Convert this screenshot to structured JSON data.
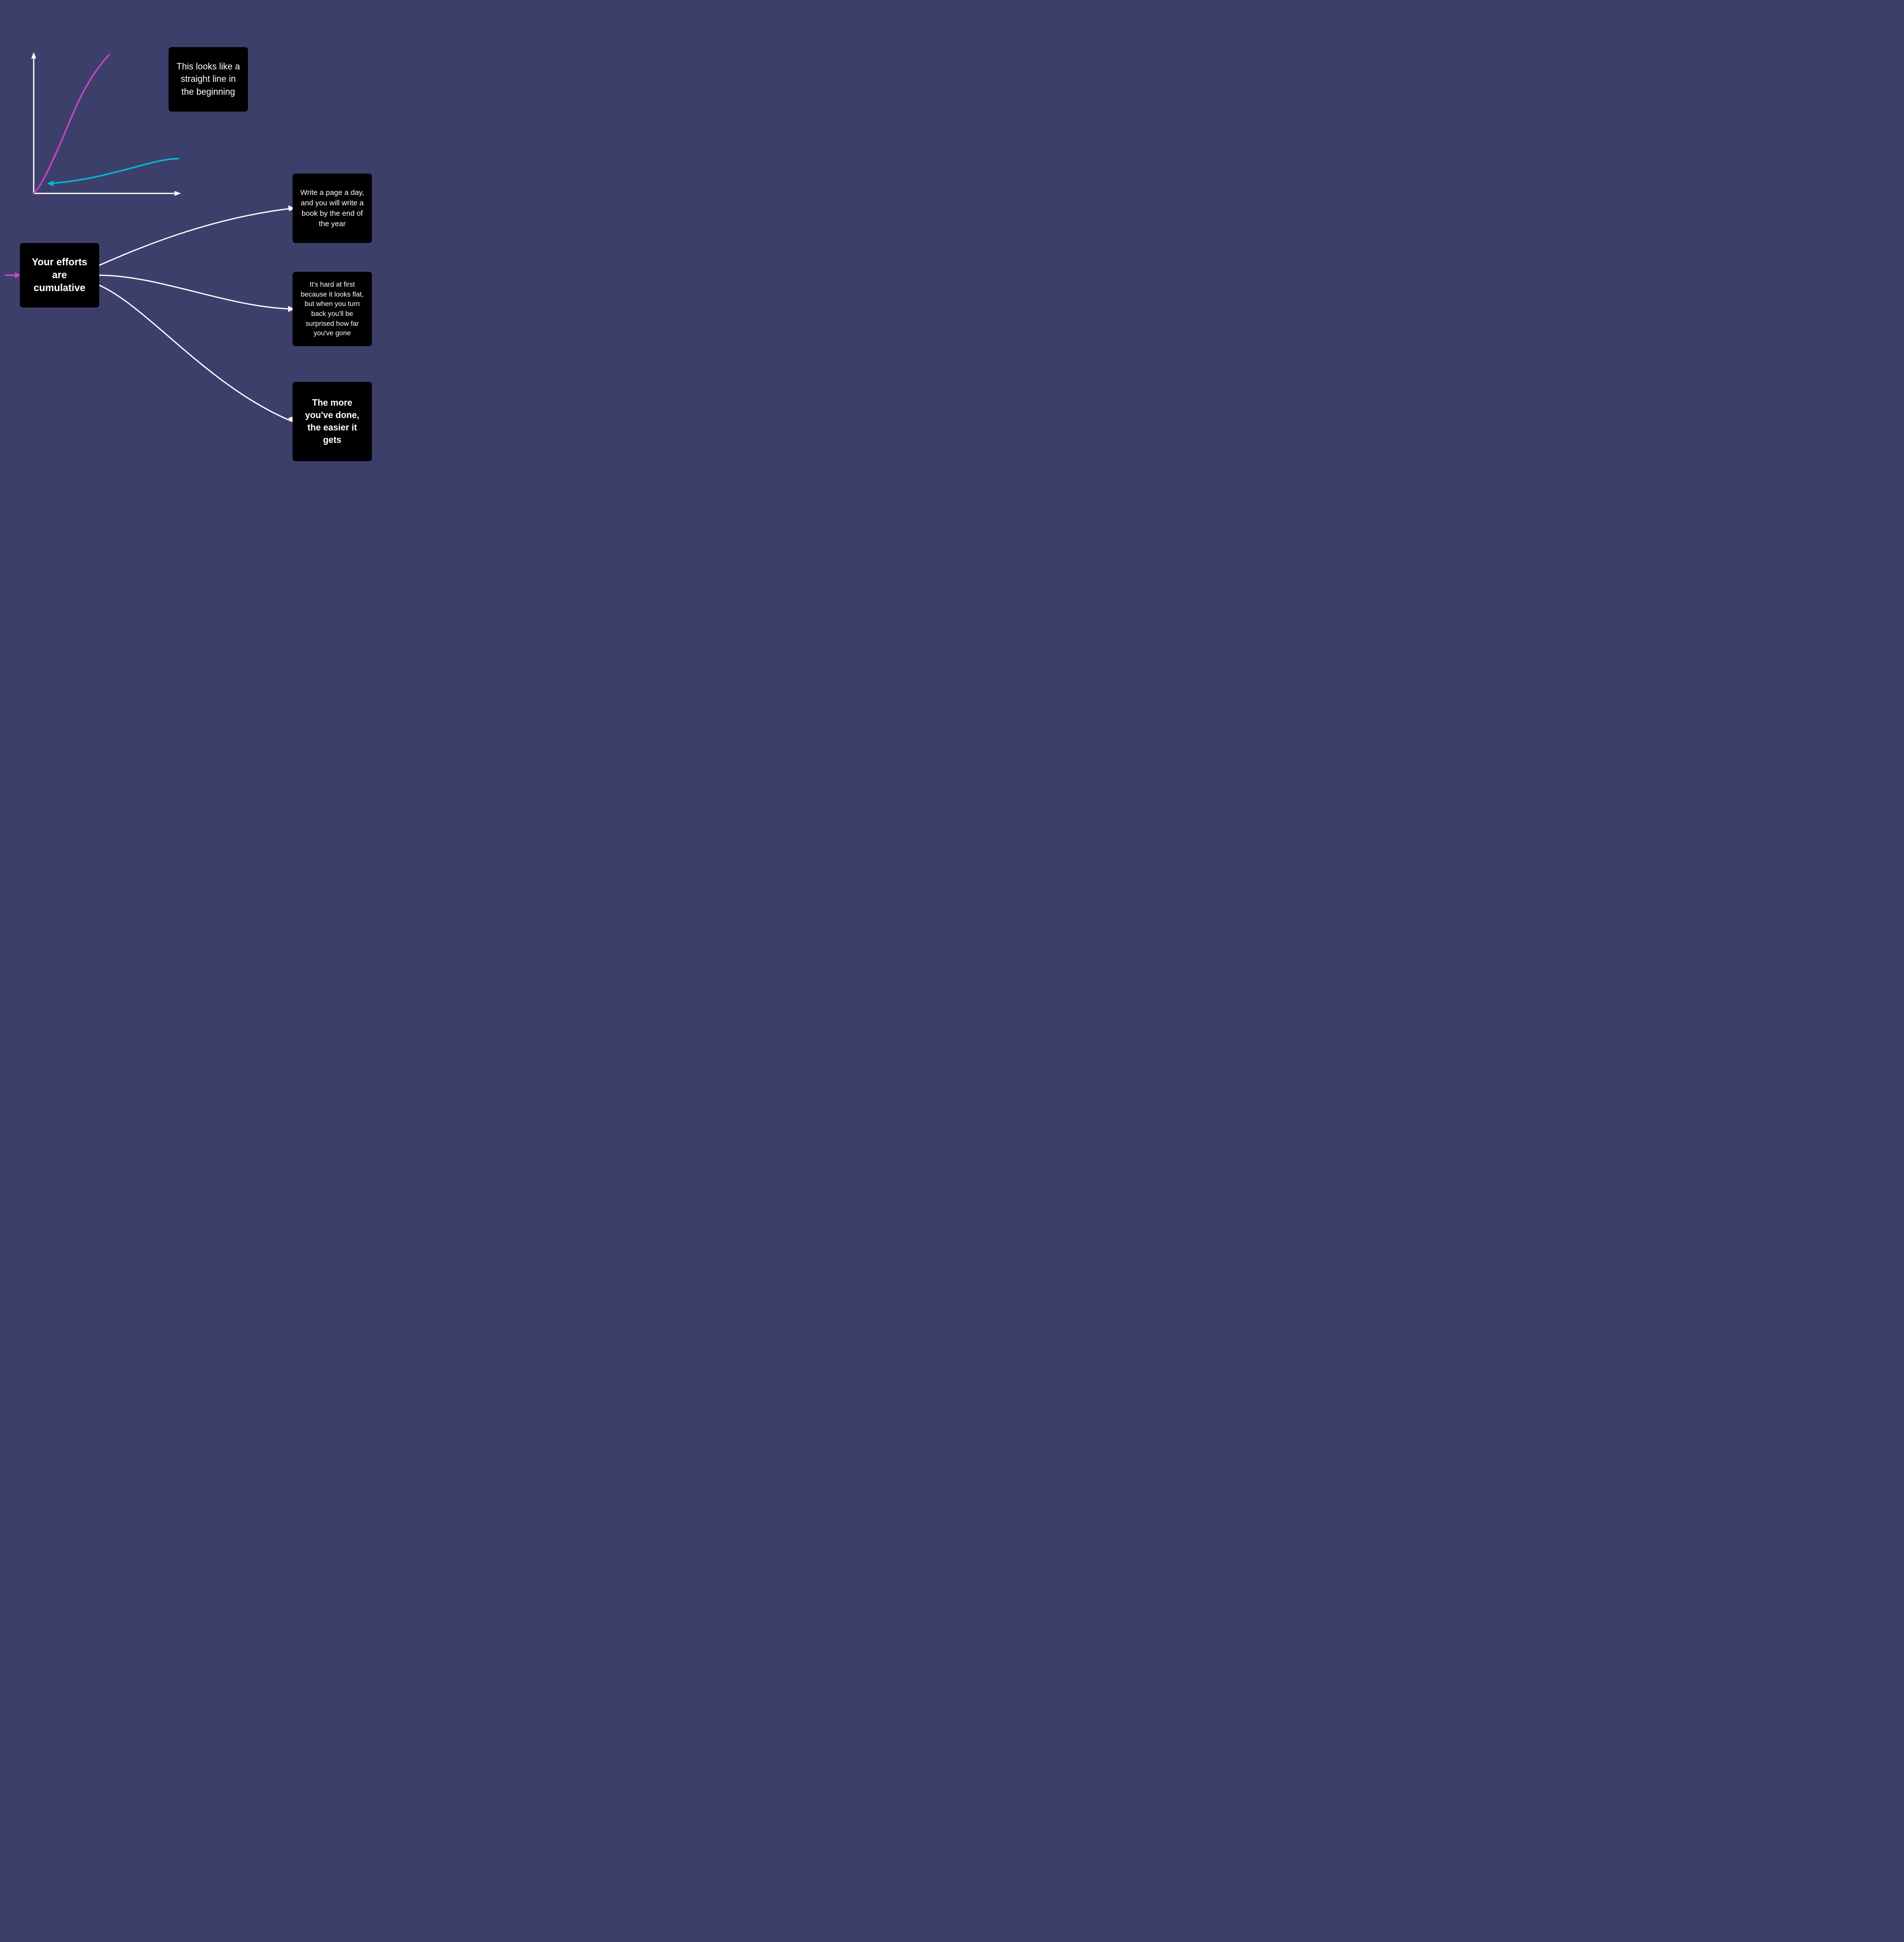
{
  "background_color": "#3d3f6b",
  "cards": {
    "straight_line": {
      "text": "This looks like a straight line in the beginning"
    },
    "cumulative": {
      "text": "Your efforts are cumulative"
    },
    "write_page": {
      "text": "Write a page a day, and you will write a book by the end of the year"
    },
    "hard_first": {
      "text": "It's hard at first because it looks flat, but when you turn back you'll be surprised how far you've gone"
    },
    "easier": {
      "text": "The more you've done, the easier it gets"
    }
  },
  "colors": {
    "background": "#3d3f6b",
    "white": "#ffffff",
    "purple": "#cc44cc",
    "cyan": "#00bcd4",
    "card_bg": "#000000"
  }
}
